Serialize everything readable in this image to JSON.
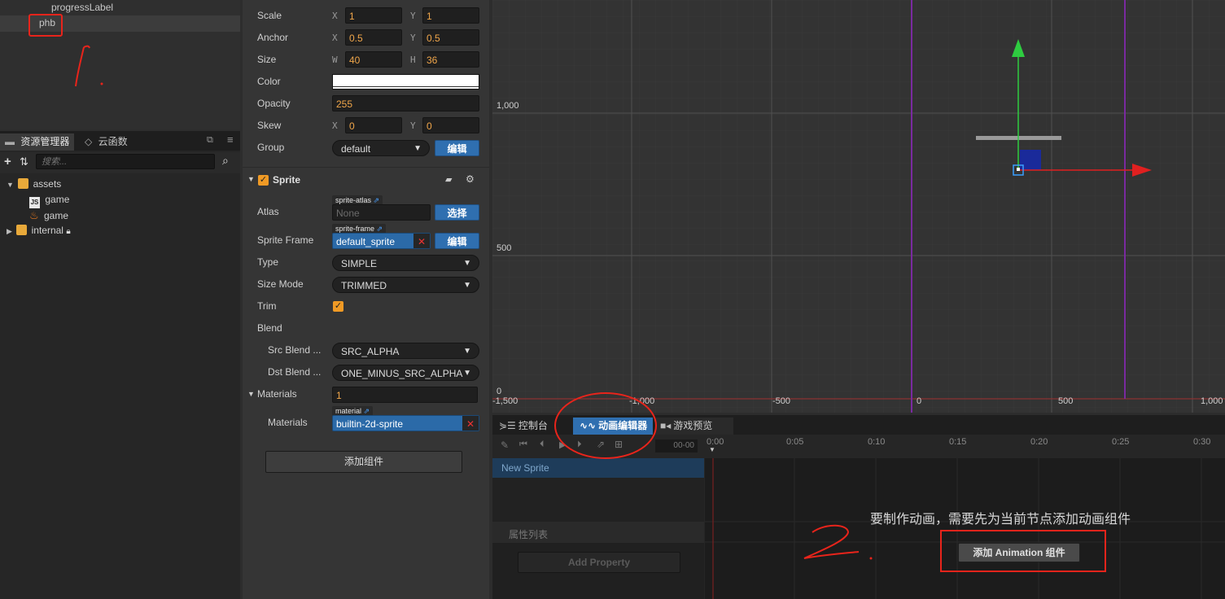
{
  "hierarchy": {
    "items": [
      {
        "label": "progressLabel"
      },
      {
        "label": "phb"
      }
    ]
  },
  "assets_panel": {
    "tabs": [
      {
        "label": "资源管理器"
      },
      {
        "label": "云函数"
      }
    ],
    "search_placeholder": "搜索...",
    "tree": [
      {
        "label": "assets",
        "expanded": true
      },
      {
        "label": "game",
        "kind": "js"
      },
      {
        "label": "game",
        "kind": "fire"
      },
      {
        "label": "internal",
        "locked": true
      }
    ]
  },
  "inspector": {
    "scale": {
      "label": "Scale",
      "x": "1",
      "y": "1"
    },
    "anchor": {
      "label": "Anchor",
      "x": "0.5",
      "y": "0.5"
    },
    "size": {
      "label": "Size",
      "w": "40",
      "h": "36"
    },
    "color": {
      "label": "Color",
      "value": "#ffffff"
    },
    "opacity": {
      "label": "Opacity",
      "value": "255"
    },
    "skew": {
      "label": "Skew",
      "x": "0",
      "y": "0"
    },
    "group": {
      "label": "Group",
      "value": "default",
      "button": "编辑"
    },
    "axis_labels": {
      "x": "X",
      "y": "Y",
      "w": "W",
      "h": "H"
    },
    "sprite": {
      "title": "Sprite",
      "atlas": {
        "label": "Atlas",
        "tag": "sprite-atlas",
        "value": "None",
        "button": "选择"
      },
      "sprite_frame": {
        "label": "Sprite Frame",
        "tag": "sprite-frame",
        "value": "default_sprite",
        "button": "编辑"
      },
      "type": {
        "label": "Type",
        "value": "SIMPLE"
      },
      "size_mode": {
        "label": "Size Mode",
        "value": "TRIMMED"
      },
      "trim": {
        "label": "Trim",
        "checked": true
      },
      "blend": {
        "label": "Blend"
      },
      "src_blend": {
        "label": "Src Blend ...",
        "value": "SRC_ALPHA"
      },
      "dst_blend": {
        "label": "Dst Blend ...",
        "value": "ONE_MINUS_SRC_ALPHA"
      },
      "materials_group": {
        "label": "Materials",
        "count": "1"
      },
      "materials": {
        "label": "Materials",
        "tag": "material",
        "value": "builtin-2d-sprite"
      }
    },
    "add_component": "添加组件"
  },
  "scene": {
    "y_labels": [
      "1,000",
      "500",
      "0"
    ],
    "x_labels": [
      "-1,500",
      "-1,000",
      "-500",
      "0",
      "500",
      "1,000"
    ]
  },
  "bottom_panel": {
    "tabs": [
      {
        "label": "控制台"
      },
      {
        "label": "动画编辑器",
        "active": true
      },
      {
        "label": "游戏预览"
      }
    ],
    "time_field": "00-00",
    "timeline_labels": [
      "0:00",
      "0:05",
      "0:10",
      "0:15",
      "0:20",
      "0:25",
      "0:30"
    ],
    "node_name": "New Sprite",
    "property_list_label": "属性列表",
    "add_property": "Add Property",
    "hint": "要制作动画，需要先为当前节点添加动画组件",
    "add_animation_button": "添加 Animation 组件"
  },
  "annotations": {
    "one": "1.",
    "two": "2."
  },
  "colors": {
    "accent": "#2f6fb0",
    "checkbox": "#f09a25",
    "highlight": "#e8241b"
  }
}
